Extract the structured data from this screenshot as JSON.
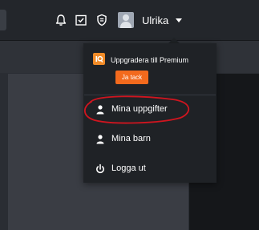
{
  "header": {
    "username": "Ulrika",
    "icons": [
      "bell-icon",
      "checklist-icon",
      "shield-icon"
    ]
  },
  "dropdown": {
    "premium": {
      "logo_text": "iq",
      "text": "Uppgradera till Premium",
      "button_label": "Ja tack"
    },
    "items": [
      {
        "label": "Mina uppgifter",
        "icon": "user-icon"
      },
      {
        "label": "Mina barn",
        "icon": "user-icon"
      },
      {
        "label": "Logga ut",
        "icon": "power-icon"
      }
    ]
  },
  "colors": {
    "accent": "#f36a1d",
    "annotation": "#d0151f",
    "menu_bg": "#1f2226"
  }
}
